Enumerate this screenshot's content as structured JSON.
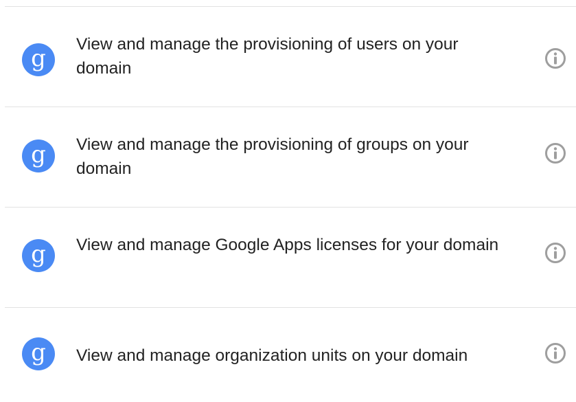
{
  "icons": {
    "app_icon": "google-g-icon",
    "app_icon_glyph": "g",
    "info_icon": "info-icon"
  },
  "colors": {
    "icon_background": "#4a8af4",
    "info_icon": "#9e9e9e",
    "divider": "#e2e2e2",
    "text": "#222222"
  },
  "permissions": [
    {
      "label": "View and manage the provisioning of users on your domain"
    },
    {
      "label": "View and manage the provisioning of groups on your domain"
    },
    {
      "label": "View and manage Google Apps licenses for your domain"
    },
    {
      "label": "View and manage organization units on your domain"
    }
  ]
}
